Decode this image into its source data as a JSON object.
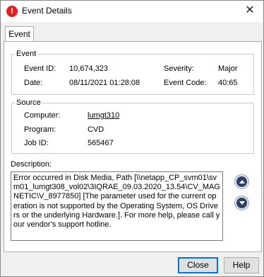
{
  "window": {
    "title": "Event Details",
    "app_icon_glyph": "!",
    "close_glyph": "✕"
  },
  "tabs": [
    {
      "label": "Event"
    }
  ],
  "event_group": {
    "legend": "Event",
    "event_id_label": "Event ID:",
    "event_id": "10,674,323",
    "severity_label": "Severity:",
    "severity": "Major",
    "date_label": "Date:",
    "date": "08/11/2021 01:28:08",
    "event_code_label": "Event Code:",
    "event_code": "40:65"
  },
  "source_group": {
    "legend": "Source",
    "computer_label": "Computer:",
    "computer": "lumgt310",
    "program_label": "Program:",
    "program": "CVD",
    "job_id_label": "Job ID:",
    "job_id": "565467"
  },
  "description": {
    "label": "Description:",
    "text": "Error occurred in Disk Media, Path [\\\\netapp_CP_svm01\\svm01_lumgt308_vol02\\3IQRAE_09.03.2020_13.54\\CV_MAGNETIC\\V_8977850] [The parameter used for the current operation is not supported by the Operating System, OS Drivers or the underlying Hardware.]. For more help, please call your vendor's support hotline."
  },
  "buttons": {
    "close": "Close",
    "help": "Help"
  },
  "icons": {
    "app": "error-icon",
    "scroll_up": "scroll-up-icon",
    "scroll_down": "scroll-down-icon"
  },
  "colors": {
    "app_icon": "#e02020",
    "focus_border": "#0078d7",
    "nav_button": "#2c3f66"
  }
}
